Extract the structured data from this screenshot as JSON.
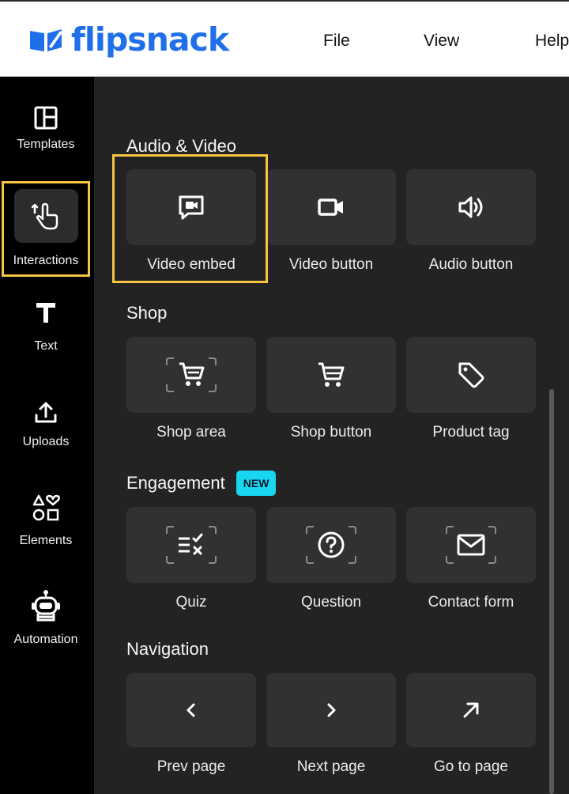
{
  "header": {
    "logo_text": "flipsnack",
    "menu": [
      {
        "label": "File"
      },
      {
        "label": "View"
      },
      {
        "label": "Help"
      }
    ]
  },
  "colors": {
    "brand": "#1f6fea",
    "highlight": "#f5c542",
    "badge": "#18d6f0",
    "panel_bg": "#232323",
    "tile_bg": "#313131"
  },
  "sidebar": {
    "items": [
      {
        "label": "Templates",
        "icon": "layout-icon"
      },
      {
        "label": "Interactions",
        "icon": "tap-gesture-icon",
        "selected": true
      },
      {
        "label": "Text",
        "icon": "text-icon"
      },
      {
        "label": "Uploads",
        "icon": "upload-icon"
      },
      {
        "label": "Elements",
        "icon": "shapes-icon"
      },
      {
        "label": "Automation",
        "icon": "robot-icon"
      }
    ]
  },
  "sections": {
    "audio_video": {
      "title": "Audio & Video",
      "tiles": [
        {
          "label": "Video embed",
          "icon": "video-embed-icon",
          "highlighted": true
        },
        {
          "label": "Video button",
          "icon": "video-camera-icon"
        },
        {
          "label": "Audio button",
          "icon": "speaker-icon"
        }
      ]
    },
    "shop": {
      "title": "Shop",
      "tiles": [
        {
          "label": "Shop area",
          "icon": "cart-area-icon"
        },
        {
          "label": "Shop button",
          "icon": "cart-icon"
        },
        {
          "label": "Product tag",
          "icon": "tag-icon"
        }
      ]
    },
    "engagement": {
      "title": "Engagement",
      "badge": "NEW",
      "tiles": [
        {
          "label": "Quiz",
          "icon": "quiz-icon"
        },
        {
          "label": "Question",
          "icon": "question-icon"
        },
        {
          "label": "Contact form",
          "icon": "mail-icon"
        }
      ]
    },
    "navigation": {
      "title": "Navigation",
      "tiles": [
        {
          "label": "Prev page",
          "icon": "chevron-left-icon"
        },
        {
          "label": "Next page",
          "icon": "chevron-right-icon"
        },
        {
          "label": "Go to page",
          "icon": "arrow-up-right-icon"
        }
      ]
    }
  }
}
